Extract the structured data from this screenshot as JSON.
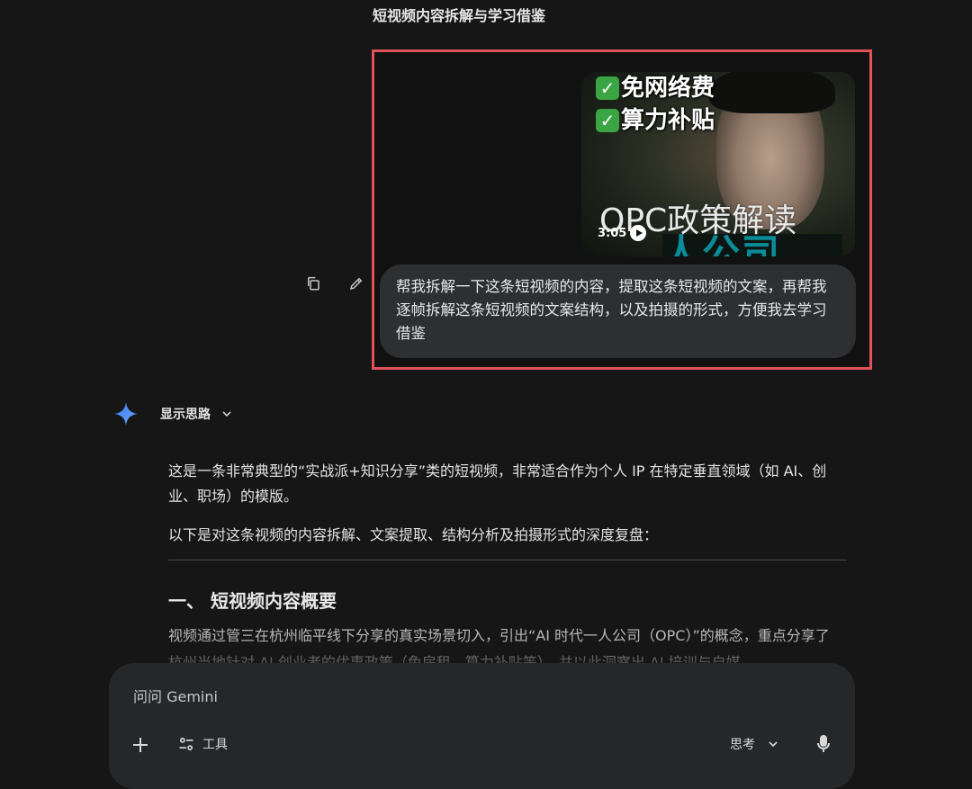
{
  "conversation": {
    "title": "短视频内容拆解与学习借鉴"
  },
  "user_message": {
    "video": {
      "overlay_line_1": "免网络费",
      "overlay_line_2": "算力补贴",
      "caption": "OPC政策解读",
      "bottom_text": "人公司",
      "duration": "3:05"
    },
    "text": "帮我拆解一下这条短视频的内容，提取这条短视频的文案，再帮我逐帧拆解这条短视频的文案结构，以及拍摄的形式，方便我去学习借鉴"
  },
  "response": {
    "show_thinking_label": "显示思路",
    "paragraph_1": "这是一条非常典型的“实战派+知识分享”类的短视频，非常适合作为个人 IP 在特定垂直领域（如 AI、创业、职场）的模版。",
    "paragraph_2": "以下是对这条视频的内容拆解、文案提取、结构分析及拍摄形式的深度复盘：",
    "heading_1": "一、 短视频内容概要",
    "paragraph_3": "视频通过管三在杭州临平线下分享的真实场景切入，引出“AI 时代一人公司（OPC）”的概念，重点分享了杭州当地针对 AI 创业者的优惠政策（免房租、算力补贴等），并以此洞察出 AI 培训与自媒"
  },
  "composer": {
    "placeholder": "问问 Gemini",
    "tools_label": "工具",
    "mode_label": "思考"
  },
  "colors": {
    "background": "#161617",
    "highlight_border": "#e0525a",
    "bubble": "#2d2f31",
    "composer": "#262729",
    "gemini_blue": "#4c8df6"
  }
}
